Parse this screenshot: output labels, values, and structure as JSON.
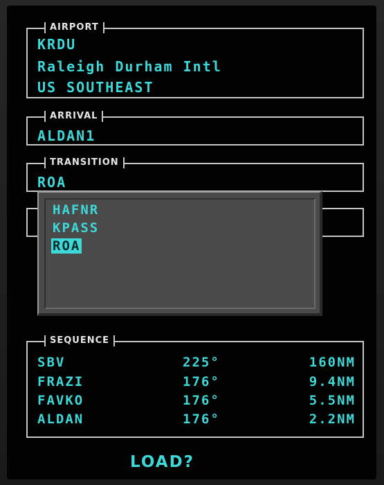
{
  "airport": {
    "legend": "AIRPORT",
    "ident": "KRDU",
    "name": "Raleigh Durham Intl",
    "region": "US SOUTHEAST"
  },
  "arrival": {
    "legend": "ARRIVAL",
    "value": "ALDAN1"
  },
  "transition": {
    "legend": "TRANSITION",
    "value": "ROA",
    "options": [
      {
        "label": "HAFNR",
        "selected": false
      },
      {
        "label": "KPASS",
        "selected": false
      },
      {
        "label": "ROA",
        "selected": true
      }
    ]
  },
  "sequence": {
    "legend": "SEQUENCE",
    "rows": [
      {
        "fix": "SBV",
        "course": "225°",
        "distance": "160NM"
      },
      {
        "fix": "FRAZI",
        "course": "176°",
        "distance": "9.4NM"
      },
      {
        "fix": "FAVKO",
        "course": "176°",
        "distance": "5.5NM"
      },
      {
        "fix": "ALDAN",
        "course": "176°",
        "distance": "2.2NM"
      }
    ]
  },
  "load_prompt": "LOAD?",
  "colors": {
    "text_cyan": "#3fd8d8",
    "border": "#c8c8c8",
    "dropdown_bg": "#4a4a4a",
    "screen_bg": "#020202"
  }
}
